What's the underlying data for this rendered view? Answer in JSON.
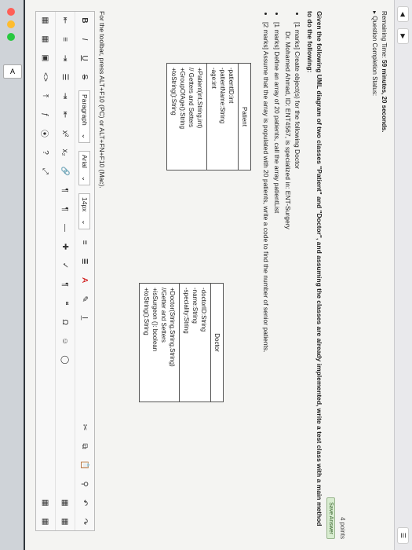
{
  "browser": {
    "tab_label": "A"
  },
  "info": {
    "time_label": "Remaining Time:",
    "time_value": "59 minutes, 20 seconds.",
    "completion": "Question Completion Status:"
  },
  "question": {
    "points": "4 points",
    "save_label": "Save Answer",
    "intro": "Given the following UML diagram of two classes \"Patient\" and \"Doctor\", and assuming the classes are already implemented, write a test class with a main method to do the following:",
    "bullet1": "[1 marks] Create object(s) for the following Doctor",
    "doctor_line": "Dr. Mohamed Ahmad, ID: ENT4567, is specialized in: ENT-Surgery",
    "bullet2": "[1 marks] Define an array of 20 patients, call the array patientList",
    "bullet3": "[2 marks] Assume that the array is populated with 20 patients, write a code to find the number of senior patients."
  },
  "uml": {
    "patient": {
      "title": "Patient",
      "attributes": [
        "-patientID:int",
        "-patientName:String",
        "-age:int"
      ],
      "methods": [
        "+Patient(int,String,int)",
        "// Getters and Setters",
        "+GroupOfAge():String",
        "+toString():String"
      ]
    },
    "doctor": {
      "title": "Doctor",
      "attributes": [
        "-doctorID:String",
        "-name:String",
        "-speciality:String"
      ],
      "methods": [
        "+Doctor(String,String,String)",
        "//Getter and Setters",
        "+isSurgeon (): boolean",
        "+toString():String"
      ]
    }
  },
  "editor": {
    "help_text": "For the toolbar, press ALT+F10 (PC) or ALT+FN+F10 (Mac).",
    "paragraph_value": "Paragraph",
    "font_value": "Arial",
    "size_value": "14px"
  },
  "icons": {
    "bold": "B",
    "italic": "I",
    "underline": "U",
    "strike": "S",
    "superscript": "x²",
    "subscript": "x₂",
    "omega": "Ω"
  }
}
